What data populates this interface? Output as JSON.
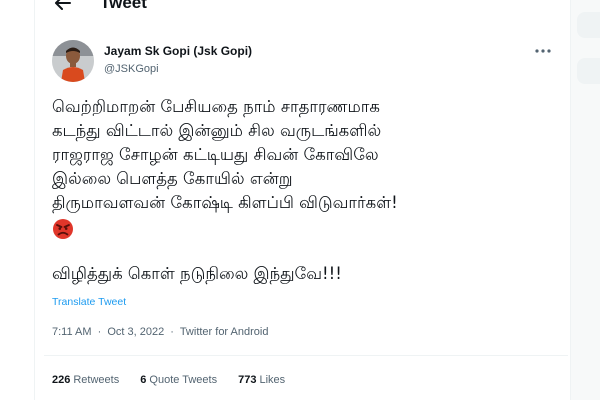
{
  "header": {
    "back_icon": "back-arrow-icon",
    "title": "Tweet"
  },
  "tweet": {
    "author_name": "Jayam Sk Gopi (Jsk Gopi)",
    "author_handle": "@JSKGopi",
    "more_icon": "more-options-icon",
    "lines": [
      "வெற்றிமாறன் பேசியதை நாம் சாதாரணமாக",
      "கடந்து விட்டால் இன்னும் சில வருடங்களில்",
      "ராஜராஜ சோழன் கட்டியது சிவன் கோவிலே",
      "இல்லை பௌத்த கோயில் என்று",
      "திருமாவளவன் கோஷ்டி கிளப்பி விடுவார்கள்!"
    ],
    "emoji": "angry-face-icon",
    "closing_line": "விழித்துக் கொள் நடுநிலை இந்துவே!!!",
    "translate_label": "Translate Tweet",
    "time": "7:11 AM",
    "separator": "·",
    "date": "Oct 3, 2022",
    "source": "Twitter for Android"
  },
  "stats": {
    "retweets_count": "226",
    "retweets_label": "Retweets",
    "quotes_count": "6",
    "quotes_label": "Quote Tweets",
    "likes_count": "773",
    "likes_label": "Likes"
  },
  "colors": {
    "link": "#1d9bf0",
    "text": "#0f1419",
    "muted": "#536471",
    "emoji": "#e0362a"
  }
}
